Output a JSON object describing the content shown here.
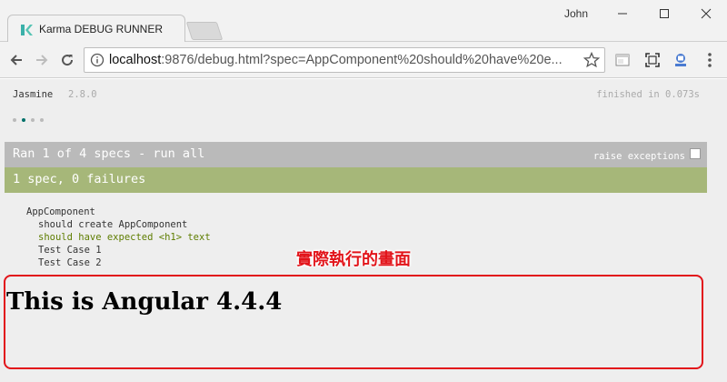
{
  "browser": {
    "tab_title": "Karma DEBUG RUNNER",
    "user_name": "John",
    "url_host": "localhost",
    "url_rest": ":9876/debug.html?spec=AppComponent%20should%20have%20e..."
  },
  "jasmine": {
    "name": "Jasmine",
    "version": "2.8.0",
    "duration": "finished in 0.073s",
    "symbols": [
      "pending",
      "passed",
      "pending",
      "pending"
    ],
    "menu_bar": "Ran 1 of 4 specs - run all",
    "raise_exceptions": "raise exceptions",
    "summary": "1 spec, 0 failures",
    "suite": "AppComponent",
    "specs": [
      {
        "label": "should create AppComponent",
        "status": "skipped"
      },
      {
        "label": "should have expected <h1> text",
        "status": "passed"
      },
      {
        "label": "Test Case 1",
        "status": "skipped"
      },
      {
        "label": "Test Case 2",
        "status": "skipped"
      }
    ]
  },
  "rendered": {
    "heading": "This is Angular 4.4.4",
    "annotation": "實際執行的畫面"
  },
  "colors": {
    "passed": "#a6b779",
    "menu": "#bababa",
    "annotation": "#e2141a"
  }
}
